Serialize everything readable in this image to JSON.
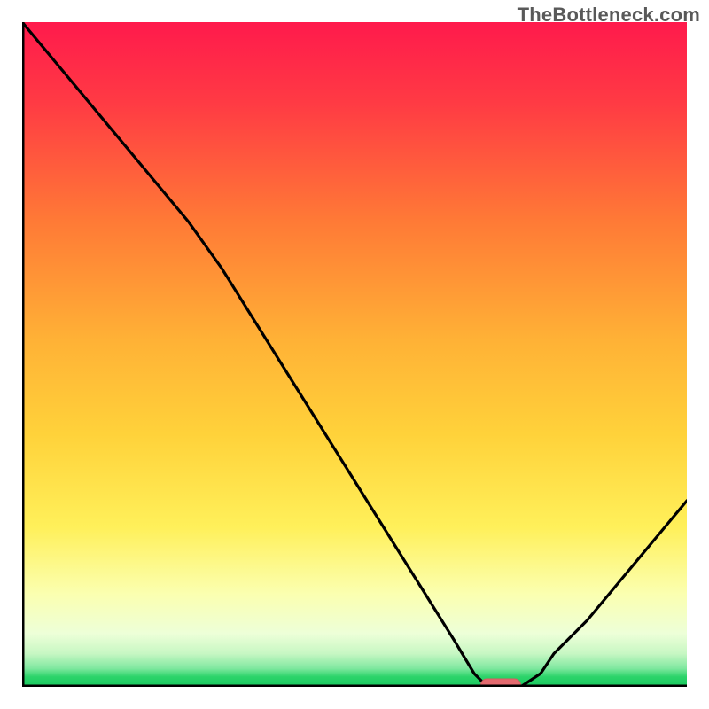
{
  "watermark": "TheBottleneck.com",
  "colors": {
    "gradient_top": "#ff1a4c",
    "gradient_mid_upper": "#ff8a33",
    "gradient_mid": "#ffd23a",
    "gradient_mid_lower": "#fff36b",
    "gradient_pale": "#fbffd1",
    "gradient_green": "#2cd46a",
    "curve": "#000000",
    "axis": "#000000",
    "marker_fill": "#e46a6f",
    "marker_stroke": "#d85a60"
  },
  "chart_data": {
    "type": "line",
    "title": "",
    "xlabel": "",
    "ylabel": "",
    "xlim": [
      0,
      100
    ],
    "ylim": [
      0,
      100
    ],
    "x": [
      0,
      5,
      10,
      15,
      20,
      25,
      30,
      35,
      40,
      45,
      50,
      55,
      60,
      65,
      68,
      70,
      73,
      75,
      78,
      80,
      85,
      90,
      95,
      100
    ],
    "values": [
      100,
      94,
      88,
      82,
      76,
      70,
      63,
      55,
      47,
      39,
      31,
      23,
      15,
      7,
      2,
      0,
      0,
      0,
      2,
      5,
      10,
      16,
      22,
      28
    ],
    "marker": {
      "x": 72,
      "y": 0,
      "width": 6,
      "height": 2
    },
    "annotations": []
  }
}
